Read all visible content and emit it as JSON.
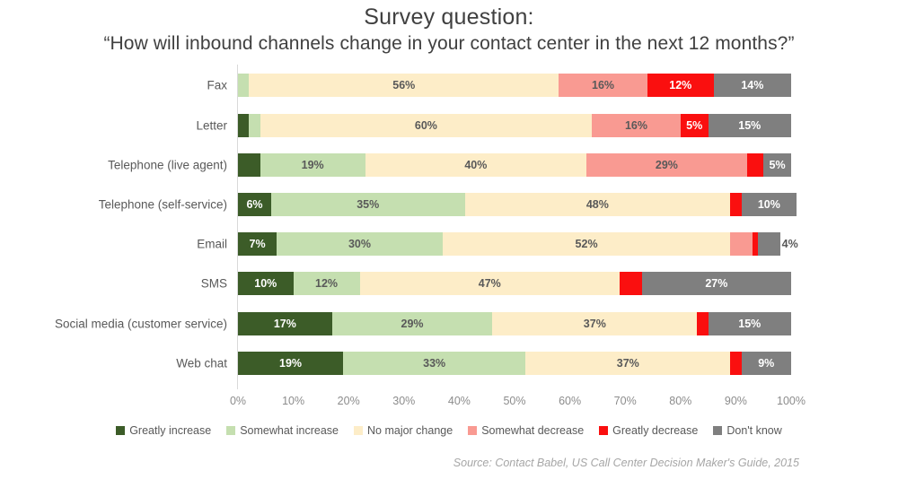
{
  "title": {
    "main": "Survey question:",
    "sub": "“How will inbound channels change in your contact center in the next 12 months?”"
  },
  "source": "Source: Contact Babel, US Call Center Decision Maker's Guide, 2015",
  "chart_data": {
    "type": "bar",
    "orientation": "horizontal",
    "stacked": true,
    "title": "Survey question: “How will inbound channels change in your contact center in the next 12 months?”",
    "xlabel": "",
    "ylabel": "",
    "xlim": [
      0,
      100
    ],
    "xticks": [
      "0%",
      "10%",
      "20%",
      "30%",
      "40%",
      "50%",
      "60%",
      "70%",
      "80%",
      "90%",
      "100%"
    ],
    "grid": false,
    "legend_position": "bottom",
    "categories": [
      "Fax",
      "Letter",
      "Telephone (live agent)",
      "Telephone (self-service)",
      "Email",
      "SMS",
      "Social media (customer service)",
      "Web chat"
    ],
    "series": [
      {
        "name": "Greatly increase",
        "color": "#3c5c28",
        "label_color": "#ffffff",
        "values": [
          0,
          2,
          4,
          6,
          7,
          10,
          17,
          19
        ],
        "labels": [
          "",
          "2",
          "4%",
          "6%",
          "7%",
          "10%",
          "17%",
          "19%"
        ]
      },
      {
        "name": "Somewhat increase",
        "color": "#c5dfb0",
        "label_color": "#595959",
        "values": [
          2,
          2,
          19,
          35,
          30,
          12,
          29,
          33
        ],
        "labels": [
          "2%",
          "2%",
          "19%",
          "35%",
          "30%",
          "12%",
          "29%",
          "33%"
        ]
      },
      {
        "name": "No major change",
        "color": "#fdedc8",
        "label_color": "#595959",
        "values": [
          56,
          60,
          40,
          48,
          52,
          47,
          37,
          37
        ],
        "labels": [
          "56%",
          "60%",
          "40%",
          "48%",
          "52%",
          "47%",
          "37%",
          "37%"
        ]
      },
      {
        "name": "Somewhat decrease",
        "color": "#f99a92",
        "label_color": "#595959",
        "values": [
          16,
          16,
          29,
          0,
          4,
          0,
          0,
          0
        ],
        "labels": [
          "16%",
          "16%",
          "29%",
          "",
          "4%",
          "",
          "",
          ""
        ]
      },
      {
        "name": "Greatly decrease",
        "color": "#fa0f0f",
        "label_color": "#ffffff",
        "values": [
          12,
          5,
          3,
          2,
          1,
          4,
          2,
          2
        ],
        "labels": [
          "12%",
          "5%",
          "3%",
          "2%",
          "1%",
          "4%",
          "2%",
          "2%"
        ]
      },
      {
        "name": "Don't know",
        "color": "#7f7f7f",
        "label_color": "#ffffff",
        "values": [
          14,
          15,
          5,
          10,
          4,
          27,
          15,
          9
        ],
        "labels": [
          "14%",
          "15%",
          "5%",
          "10%",
          "4%",
          "27%",
          "15%",
          "9%"
        ]
      }
    ]
  }
}
